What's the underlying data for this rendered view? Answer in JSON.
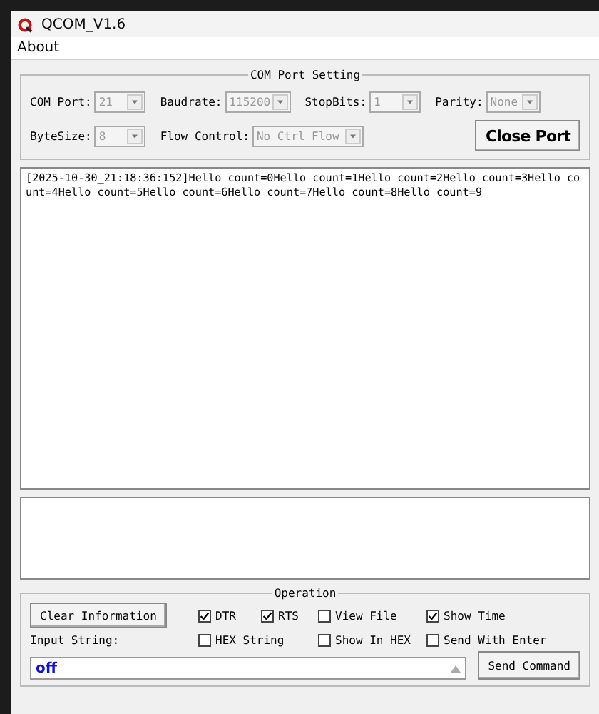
{
  "window": {
    "title": "QCOM_V1.6"
  },
  "menu": [
    {
      "label": "About"
    }
  ],
  "com_port_setting": {
    "title": "COM Port Setting",
    "rows": [
      [
        {
          "label": "COM Port:",
          "value": "21",
          "disabled": true
        },
        {
          "label": "Baudrate:",
          "value": "115200",
          "disabled": true
        },
        {
          "label": "StopBits:",
          "value": "1",
          "disabled": true
        },
        {
          "label": "Parity:",
          "value": "None",
          "disabled": true
        }
      ],
      [
        {
          "label": "ByteSize:",
          "value": "8",
          "disabled": true
        },
        {
          "label": "Flow Control:",
          "value": "No Ctrl Flow",
          "disabled": true
        }
      ]
    ],
    "close_button": "Close Port"
  },
  "receive_log": {
    "text": "[2025-10-30_21:18:36:152]Hello count=0Hello count=1Hello count=2Hello count=3Hello count=4Hello count=5Hello count=6Hello count=7Hello count=8Hello count=9"
  },
  "operation": {
    "title": "Operation",
    "clear_button": "Clear Information",
    "checkboxes": [
      {
        "label": "DTR",
        "checked": true
      },
      {
        "label": "RTS",
        "checked": true
      },
      {
        "label": "View File",
        "checked": false
      },
      {
        "label": "Show Time",
        "checked": true
      },
      {
        "label": "HEX String",
        "checked": false
      },
      {
        "label": "Show In HEX",
        "checked": false
      },
      {
        "label": "Send With Enter",
        "checked": false
      }
    ],
    "input_label": "Input String:",
    "input_value": "off",
    "send_button": "Send Command"
  }
}
